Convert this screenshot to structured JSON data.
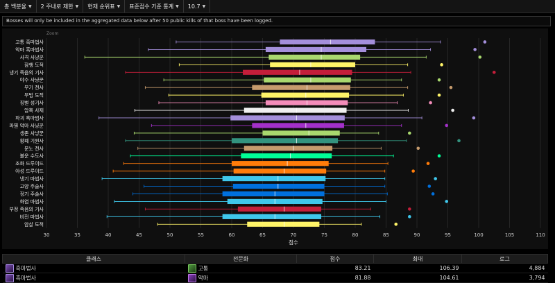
{
  "menu": [
    {
      "label": "총 백분율"
    },
    {
      "label": "2 주내로 제한"
    },
    {
      "label": "현재 순위표"
    },
    {
      "label": "표준점수 기준 통계"
    },
    {
      "label": "10.7"
    }
  ],
  "notice": "Bosses will only be included in the aggregated data below after 50 public kills of that boss have been logged.",
  "chart_zoom_label": "Zoom",
  "chart_data": {
    "type": "boxplot",
    "orientation": "horizontal",
    "xlabel": "점수",
    "xlim": [
      30,
      110
    ],
    "xticks": [
      30,
      35,
      40,
      45,
      50,
      55,
      60,
      65,
      70,
      75,
      80,
      85,
      90,
      95,
      100,
      105,
      110
    ],
    "grid": true,
    "series": [
      {
        "name": "고통 흑마법사",
        "min": 51,
        "q1": 67.8,
        "median": 76,
        "q3": 83.2,
        "max": 93.8,
        "outlier": 101,
        "color": "#a48fdb"
      },
      {
        "name": "악마 흑마법사",
        "min": 46.5,
        "q1": 65.5,
        "median": 74.5,
        "q3": 81.8,
        "max": 92.2,
        "outlier": 99.4,
        "color": "#a48fdb"
      },
      {
        "name": "사격 사냥꾼",
        "min": 36.2,
        "q1": 66,
        "median": 74.5,
        "q3": 80.8,
        "max": 91.5,
        "outlier": 100.2,
        "color": "#a9d86e"
      },
      {
        "name": "잠행 도적",
        "min": 51.5,
        "q1": 66.2,
        "median": 72.8,
        "q3": 80,
        "max": 88.5,
        "outlier": 94,
        "color": "#fff468"
      },
      {
        "name": "냉기 죽음의 기사",
        "min": 42.8,
        "q1": 61.8,
        "median": 71,
        "q3": 79.5,
        "max": 89,
        "outlier": 102.5,
        "color": "#c41e3a"
      },
      {
        "name": "야수 사냥꾼",
        "min": 49,
        "q1": 65.2,
        "median": 72.8,
        "q3": 79.3,
        "max": 87.5,
        "outlier": 93.6,
        "color": "#a9d86e"
      },
      {
        "name": "무기 전사",
        "min": 46,
        "q1": 63.3,
        "median": 72.2,
        "q3": 79.2,
        "max": 88.5,
        "outlier": 95.5,
        "color": "#c69b6d"
      },
      {
        "name": "무법 도적",
        "min": 49.8,
        "q1": 64.8,
        "median": 72,
        "q3": 79,
        "max": 87.8,
        "outlier": 93.6,
        "color": "#fff468"
      },
      {
        "name": "징벌 성기사",
        "min": 48.2,
        "q1": 65.5,
        "median": 72.2,
        "q3": 78.8,
        "max": 86.8,
        "outlier": 92.2,
        "color": "#f48cba"
      },
      {
        "name": "암흑 사제",
        "min": 44.3,
        "q1": 62,
        "median": 70.5,
        "q3": 78.6,
        "max": 88.6,
        "outlier": 95.8,
        "color": "#f0f0f0"
      },
      {
        "name": "파괴 흑마법사",
        "min": 38.5,
        "q1": 59.8,
        "median": 70.5,
        "q3": 78.3,
        "max": 90.8,
        "outlier": 99.2,
        "color": "#a48fdb"
      },
      {
        "name": "파멸 악마 사냥꾼",
        "min": 47,
        "q1": 63.3,
        "median": 72,
        "q3": 78.2,
        "max": 87.5,
        "outlier": 94.8,
        "color": "#a330c9"
      },
      {
        "name": "생존 사냥꾼",
        "min": 44.2,
        "q1": 65,
        "median": 72.5,
        "q3": 77.5,
        "max": 83.8,
        "outlier": 88.8,
        "color": "#a9d86e"
      },
      {
        "name": "황폐 기원사",
        "min": 42.8,
        "q1": 60,
        "median": 70.5,
        "q3": 77.2,
        "max": 88.3,
        "outlier": 96.8,
        "color": "#33937f"
      },
      {
        "name": "분노 전사",
        "min": 44.8,
        "q1": 62,
        "median": 70,
        "q3": 76.3,
        "max": 84.2,
        "outlier": 90.2,
        "color": "#c69b6d"
      },
      {
        "name": "불운 수도사",
        "min": 43.6,
        "q1": 61.5,
        "median": 69.5,
        "q3": 76.2,
        "max": 86.2,
        "outlier": 93.6,
        "color": "#00ff98"
      },
      {
        "name": "조화 드루이드",
        "min": 42.5,
        "q1": 60,
        "median": 69,
        "q3": 75.7,
        "max": 85.3,
        "outlier": 91.8,
        "color": "#ff7c0a"
      },
      {
        "name": "야성 드루이드",
        "min": 40.8,
        "q1": 60.3,
        "median": 68.5,
        "q3": 75.3,
        "max": 84.8,
        "outlier": 89.4,
        "color": "#ff7c0a"
      },
      {
        "name": "냉기 마법사",
        "min": 39,
        "q1": 58.5,
        "median": 67.5,
        "q3": 75.2,
        "max": 84.8,
        "outlier": 93,
        "color": "#3fc7eb"
      },
      {
        "name": "고양 주술사",
        "min": 45.8,
        "q1": 60.2,
        "median": 67.5,
        "q3": 75,
        "max": 84.8,
        "outlier": 92,
        "color": "#0070dd"
      },
      {
        "name": "정기 주술사",
        "min": 44,
        "q1": 58.5,
        "median": 67,
        "q3": 75,
        "max": 85.2,
        "outlier": 92.6,
        "color": "#0070dd"
      },
      {
        "name": "화염 마법사",
        "min": 41,
        "q1": 59.3,
        "median": 67,
        "q3": 74.7,
        "max": 85,
        "outlier": 94.8,
        "color": "#3fc7eb"
      },
      {
        "name": "부정 죽음의 기사",
        "min": 46,
        "q1": 61,
        "median": 68.5,
        "q3": 74.5,
        "max": 82.5,
        "outlier": 88.8,
        "color": "#c41e3a"
      },
      {
        "name": "비전 마법사",
        "min": 39.8,
        "q1": 58.5,
        "median": 67,
        "q3": 74.5,
        "max": 84,
        "outlier": 88.8,
        "color": "#3fc7eb"
      },
      {
        "name": "암살 도적",
        "min": 48,
        "q1": 62.5,
        "median": 68.5,
        "q3": 74.2,
        "max": 81,
        "outlier": 86.6,
        "color": "#fff468"
      }
    ]
  },
  "table": {
    "headers": [
      "클래스",
      "전문화",
      "점수",
      "최대",
      "로그"
    ],
    "rows": [
      {
        "class": "흑마법사",
        "spec": "고통",
        "score": "83.21",
        "max": "106.39",
        "logs": "4,884"
      },
      {
        "class": "흑마법사",
        "spec": "악마",
        "score": "81.88",
        "max": "104.61",
        "logs": "3,794"
      }
    ]
  }
}
